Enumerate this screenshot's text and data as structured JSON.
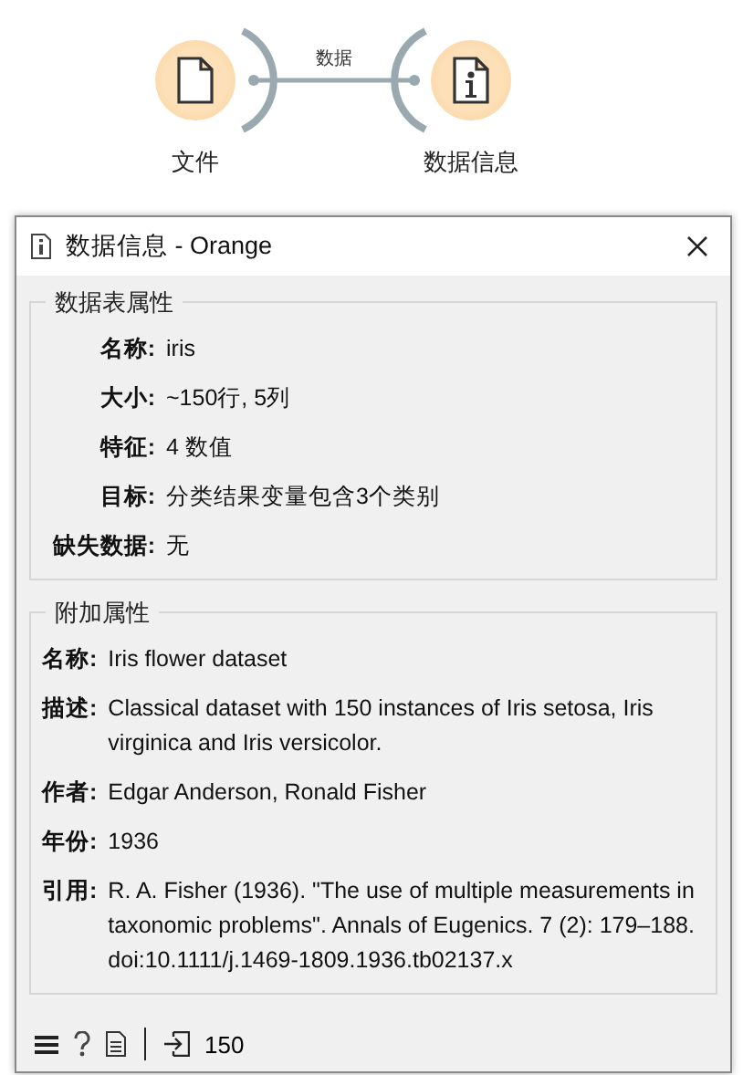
{
  "canvas": {
    "nodes": [
      {
        "label": "文件",
        "kind": "file"
      },
      {
        "label": "数据信息",
        "kind": "info"
      }
    ],
    "link": {
      "label": "数据"
    }
  },
  "window": {
    "title": "数据信息 - Orange"
  },
  "groups": [
    {
      "title": "数据表属性",
      "rows": [
        {
          "label": "名称:",
          "value": "iris"
        },
        {
          "label": "大小:",
          "value": "~150行, 5列"
        },
        {
          "label": "特征:",
          "value": "4 数值"
        },
        {
          "label": "目标:",
          "value": "分类结果变量包含3个类别"
        },
        {
          "label": "缺失数据:",
          "value": "无"
        }
      ]
    },
    {
      "title": "附加属性",
      "rows": [
        {
          "label": "名称:",
          "value": "Iris flower dataset"
        },
        {
          "label": "描述:",
          "value": "Classical dataset with 150 instances of Iris setosa, Iris virginica and Iris versicolor."
        },
        {
          "label": "作者:",
          "value": "Edgar Anderson, Ronald Fisher"
        },
        {
          "label": "年份:",
          "value": "1936"
        },
        {
          "label": "引用:",
          "value": "R. A. Fisher (1936). \"The use of multiple measurements in taxonomic problems\". Annals of Eugenics. 7 (2): 179–188. doi:10.1111/j.1469-1809.1936.tb02137.x"
        }
      ]
    }
  ],
  "status_bar": {
    "input_count": "150"
  }
}
